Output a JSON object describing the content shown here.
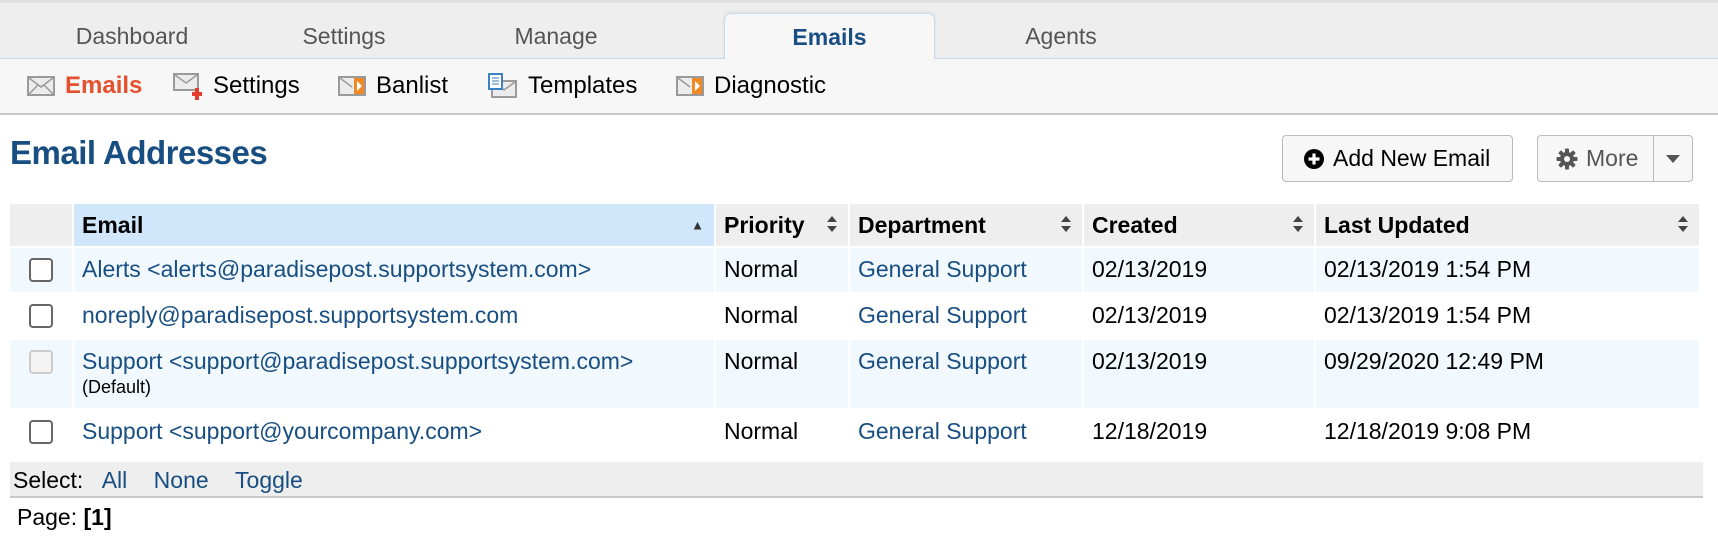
{
  "top_nav": {
    "tabs": [
      {
        "label": "Dashboard",
        "active": false
      },
      {
        "label": "Settings",
        "active": false
      },
      {
        "label": "Manage",
        "active": false
      },
      {
        "label": "Emails",
        "active": true
      },
      {
        "label": "Agents",
        "active": false
      }
    ]
  },
  "sub_nav": {
    "items": [
      {
        "label": "Emails",
        "icon": "envelope-icon",
        "active": true
      },
      {
        "label": "Settings",
        "icon": "envelope-settings-icon",
        "active": false
      },
      {
        "label": "Banlist",
        "icon": "envelope-banlist-icon",
        "active": false
      },
      {
        "label": "Templates",
        "icon": "envelope-templates-icon",
        "active": false
      },
      {
        "label": "Diagnostic",
        "icon": "envelope-diagnostic-icon",
        "active": false
      }
    ]
  },
  "page": {
    "title": "Email Addresses",
    "add_button": "Add New Email",
    "more_button": "More"
  },
  "colors": {
    "brand_blue": "#184e81",
    "active_orange": "#e4512f",
    "sorted_header": "#d0e6fb",
    "odd_row": "#f1f8fe"
  },
  "table": {
    "columns": [
      {
        "label": "Email",
        "sort": "asc"
      },
      {
        "label": "Priority",
        "sort": "none"
      },
      {
        "label": "Department",
        "sort": "none"
      },
      {
        "label": "Created",
        "sort": "none"
      },
      {
        "label": "Last Updated",
        "sort": "none"
      }
    ],
    "rows": [
      {
        "email": "Alerts <alerts@paradisepost.supportsystem.com>",
        "note": "",
        "priority": "Normal",
        "department": "General Support",
        "created": "02/13/2019",
        "updated": "02/13/2019 1:54 PM",
        "checkbox_enabled": true
      },
      {
        "email": "noreply@paradisepost.supportsystem.com",
        "note": "",
        "priority": "Normal",
        "department": "General Support",
        "created": "02/13/2019",
        "updated": "02/13/2019 1:54 PM",
        "checkbox_enabled": true
      },
      {
        "email": "Support <support@paradisepost.supportsystem.com>",
        "note": "(Default)",
        "priority": "Normal",
        "department": "General Support",
        "created": "02/13/2019",
        "updated": "09/29/2020 12:49 PM",
        "checkbox_enabled": false
      },
      {
        "email": "Support <support@yourcompany.com>",
        "note": "",
        "priority": "Normal",
        "department": "General Support",
        "created": "12/18/2019",
        "updated": "12/18/2019 9:08 PM",
        "checkbox_enabled": true
      }
    ]
  },
  "select_bar": {
    "label": "Select:",
    "all": "All",
    "none": "None",
    "toggle": "Toggle"
  },
  "pager": {
    "label": "Page:",
    "current": "[1]"
  }
}
